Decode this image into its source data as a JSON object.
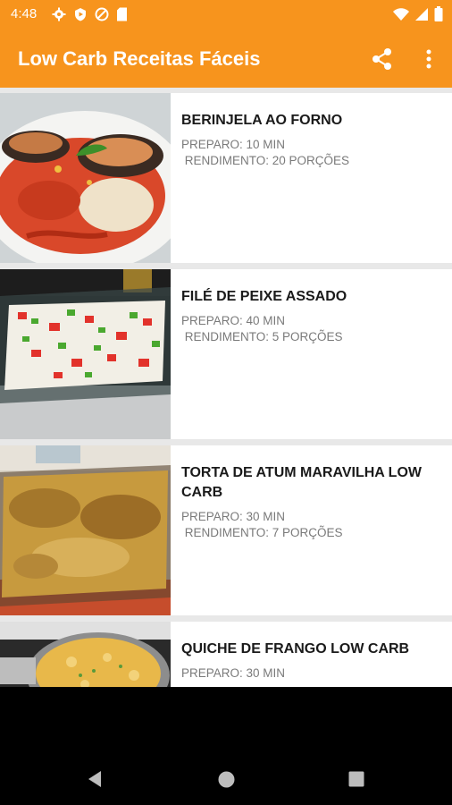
{
  "status_bar": {
    "time": "4:48"
  },
  "app_bar": {
    "title": "Low Carb Receitas Fáceis"
  },
  "recipes": [
    {
      "title": "BERINJELA AO FORNO",
      "preparo": "PREPARO: 10 MIN",
      "rendimento": " RENDIMENTO: 20 PORÇÕES"
    },
    {
      "title": "FILÉ DE PEIXE ASSADO",
      "preparo": "PREPARO: 40 MIN",
      "rendimento": " RENDIMENTO: 5 PORÇÕES"
    },
    {
      "title": "TORTA DE ATUM MARAVILHA LOW CARB",
      "preparo": "PREPARO: 30 MIN",
      "rendimento": " RENDIMENTO: 7 PORÇÕES"
    },
    {
      "title": "QUICHE DE FRANGO LOW CARB",
      "preparo": "PREPARO: 30 MIN",
      "rendimento": ""
    }
  ],
  "colors": {
    "accent": "#f7941d",
    "list_background": "#e8e8e8",
    "meta_text": "#7a7a7a"
  },
  "icons": [
    "settings-icon",
    "play-protect-icon",
    "no-disturb-icon",
    "sd-card-icon",
    "wifi-icon",
    "signal-icon",
    "battery-icon",
    "share-icon",
    "more-vert-icon",
    "nav-back-icon",
    "nav-home-icon",
    "nav-recents-icon"
  ]
}
